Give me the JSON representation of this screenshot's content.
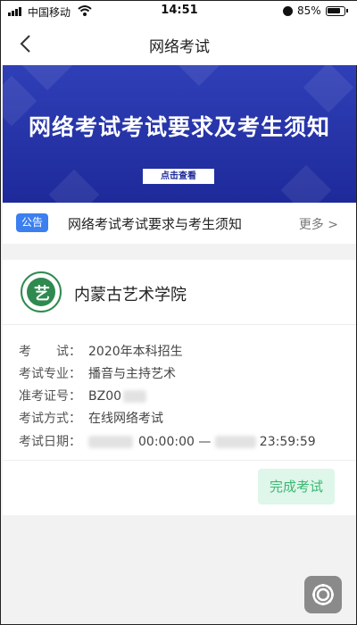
{
  "status_bar": {
    "carrier": "中国移动",
    "time": "14:51",
    "battery_pct": "85%",
    "icons": [
      "signal-icon",
      "wifi-icon",
      "alarm-icon",
      "battery-icon"
    ]
  },
  "nav": {
    "title": "网络考试",
    "back_icon": "chevron-left-icon"
  },
  "banner": {
    "title": "网络考试考试要求及考生须知",
    "button": "点击查看",
    "colors": {
      "background": "#1e2a9a"
    }
  },
  "notice": {
    "badge": "公告",
    "text": "网络考试考试要求与考生须知",
    "more": "更多 >"
  },
  "exam_card": {
    "school": "内蒙古艺术学院",
    "fields": [
      {
        "label": "考　　试：",
        "value": "2020年本科招生"
      },
      {
        "label": "考试专业：",
        "value": "播音与主持艺术"
      },
      {
        "label": "准考证号：",
        "value": "BZ00"
      },
      {
        "label": "考试方式：",
        "value": "在线网络考试"
      },
      {
        "label": "考试日期：",
        "value_start": "00:00:00",
        "separator": "—",
        "value_end": "23:59:59"
      }
    ],
    "finish_button": "完成考试",
    "colors": {
      "finish_bg": "#dff6ea",
      "finish_text": "#3bb873"
    }
  },
  "fab": {
    "icon": "gear-icon"
  }
}
